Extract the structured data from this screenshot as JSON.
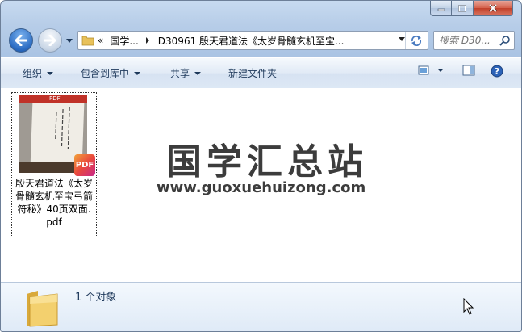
{
  "window": {
    "caption_buttons": [
      "minimize",
      "maximize",
      "close"
    ]
  },
  "address_bar": {
    "crumbs": [
      "国学...",
      "D30961 殷天君道法《太岁骨髓玄机至宝..."
    ],
    "overflow_glyph": "«"
  },
  "search": {
    "placeholder": "搜索 D30..."
  },
  "toolbar": {
    "organize": "组织",
    "include_library": "包含到库中",
    "share": "共享",
    "new_folder": "新建文件夹"
  },
  "file": {
    "thumbnail_band_text": "PDF",
    "badge": "PDF",
    "name_lines": [
      "殷天君道法《太岁",
      "骨髓玄机至宝弓箭",
      "符秘》40页双面.",
      "pdf"
    ]
  },
  "watermark": {
    "title": "国学汇总站",
    "url": "www.guoxuehuizong.com"
  },
  "details": {
    "count": "1 个对象"
  },
  "colors": {
    "accent": "#1e395b",
    "close_button": "#c1402a",
    "pdf_badge": "#e9483c"
  }
}
